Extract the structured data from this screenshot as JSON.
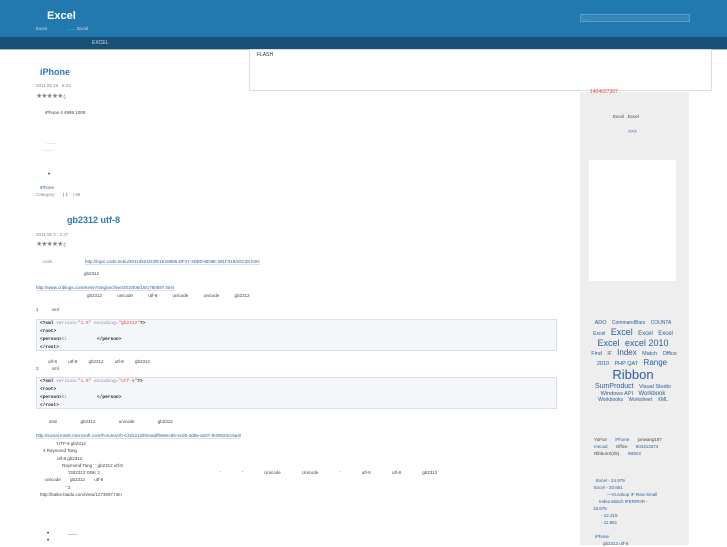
{
  "header": {
    "site_title": "Excel",
    "subtitle_left": "Excel",
    "subtitle_dots": "……",
    "subtitle_right": "Excel",
    "search_placeholder": "..."
  },
  "nav": {
    "item": "EXCEL"
  },
  "flash": {
    "text": "FLASH"
  },
  "sidebar": {
    "red_text": "1404627307",
    "excel_a": "Excel",
    "excel_b": "Excel",
    "more": ">>>",
    "tags": [
      {
        "t": "ADO",
        "s": 5.5
      },
      {
        "t": "CommandBars",
        "s": 5
      },
      {
        "t": "COUNTA",
        "s": 5
      },
      {
        "t": "Excel",
        "s": 5
      },
      {
        "t": "Excel",
        "s": 9
      },
      {
        "t": "Excel",
        "s": 6
      },
      {
        "t": "Excel",
        "s": 6
      },
      {
        "t": "Excel",
        "s": 9
      },
      {
        "t": "excel 2010",
        "s": 9
      },
      {
        "t": "Find",
        "s": 5.5
      },
      {
        "t": "IF",
        "s": 5
      },
      {
        "t": "Index",
        "s": 8
      },
      {
        "t": "Match",
        "s": 5.5
      },
      {
        "t": "Office 2010",
        "s": 5.5
      },
      {
        "t": "PHP QAT",
        "s": 5.5
      },
      {
        "t": "Range",
        "s": 8
      },
      {
        "t": "Ribbon",
        "s": 13
      },
      {
        "t": "SumProduct",
        "s": 7
      },
      {
        "t": "Visual Studio",
        "s": 5.5
      },
      {
        "t": "Windows API",
        "s": 5.5
      },
      {
        "t": "Workbook",
        "s": 6
      },
      {
        "t": "Workbooks",
        "s": 5
      },
      {
        "t": "Worksheet",
        "s": 5
      },
      {
        "t": "XML",
        "s": 5
      }
    ],
    "comments": [
      "YuFun",
      "iPhone",
      "jonwang187",
      "mecad",
      "Office",
      "504313374",
      "RibbonX(25)",
      "INDEX"
    ],
    "popular": [
      "Excel - 24.979",
      "Excel - 20.881",
      "—VLookup IF Row Small",
      "Index Match IFERROR -",
      "18.675",
      "- 12.315",
      "- 11.851"
    ],
    "recent": [
      "iPhone",
      "gb2312 utf-8"
    ]
  },
  "post1": {
    "title": "iPhone",
    "date": "2011 06 16 . 9:24",
    "stars": "★★★★★",
    "votes": "( )",
    "body": "iPhone 4 4999 1000",
    "dots1": "……",
    "dots2": "……",
    "tag": "iPhone",
    "category": "Category:",
    "meta1": "| 1",
    "meta2": "| 98"
  },
  "post2": {
    "title": "gb2312 utf-8",
    "date": "2011 06 3 . 2:37",
    "stars": "★★★★★",
    "votes": "( )",
    "src_label": "csdn",
    "link1": "http://topic.csdn.net/u/20110524/23/E1E16986-DF47-4D8D-BD9E-391F319ADC28.html",
    "gb": "gb2312",
    "link2": "http://www.cnblogs.com/KevinYang/archive/2010/06/18/1760597.html",
    "p1": "gb2312 unicode utf-8 unicode unicode gb2312",
    "n1": "1 xml",
    "code1": {
      "decl": "<?xml",
      "ver": "version=",
      "v": "\"1.0\"",
      "enc": "encoding=",
      "e": "\"gb2312\"",
      "end": "?>",
      "root": "<root>",
      "person": "<person>",
      "hi": "hi",
      "cperson": "</person>",
      "croot": "</root>"
    },
    "p2": "utf-8 utf-8 gb2312 utf-8 gb2312",
    "n2": "2 xml",
    "code2": {
      "e": "\"utf-8\""
    },
    "p3": "ansi gb2312 unicode gb2312",
    "link3": "http://social.msdn.microsoft.com/Forums/zh-CN/2212/thread/f656ec85-2cd0-4d8a-a207-fe30523cc5a4/",
    "lines": [
      "'UTF-8 gb2312",
      "4 Raymond Tang",
      "utf-8 gb2312",
      "Raymond Tang ' ' gb2312 utf-8",
      "'GB2312 GBK 2",
      "' ' Unicode Unicode ' utf-8 utf-8 gb2312",
      "unicode gb2312 utf-8",
      "' '2",
      "http://baike.baidu.com/view/1273097.htm"
    ],
    "bullet_link": "——"
  }
}
